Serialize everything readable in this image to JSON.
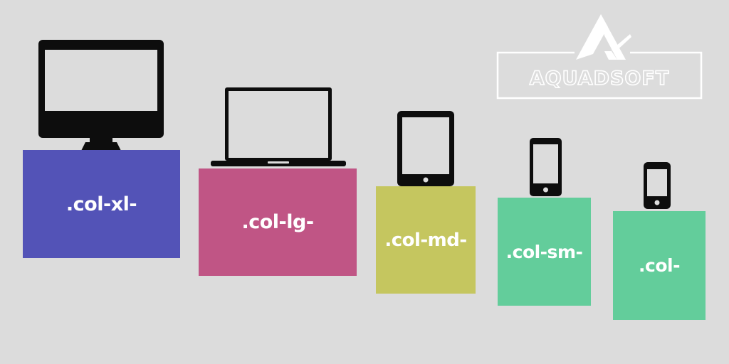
{
  "breakpoints": [
    {
      "label": ".col-xl-",
      "device": "desktop-monitor-icon",
      "color": "#5353b7"
    },
    {
      "label": ".col-lg-",
      "device": "laptop-icon",
      "color": "#c05585"
    },
    {
      "label": ".col-md-",
      "device": "tablet-icon",
      "color": "#c5c65f"
    },
    {
      "label": ".col-sm-",
      "device": "phone-icon",
      "color": "#63cd9b"
    },
    {
      "label": ".col-",
      "device": "small-phone-icon",
      "color": "#63cd9b"
    }
  ],
  "logo": {
    "text": "AQUADSOFT"
  },
  "background": "#dcdcdc",
  "icon_color": "#0d0d0d"
}
